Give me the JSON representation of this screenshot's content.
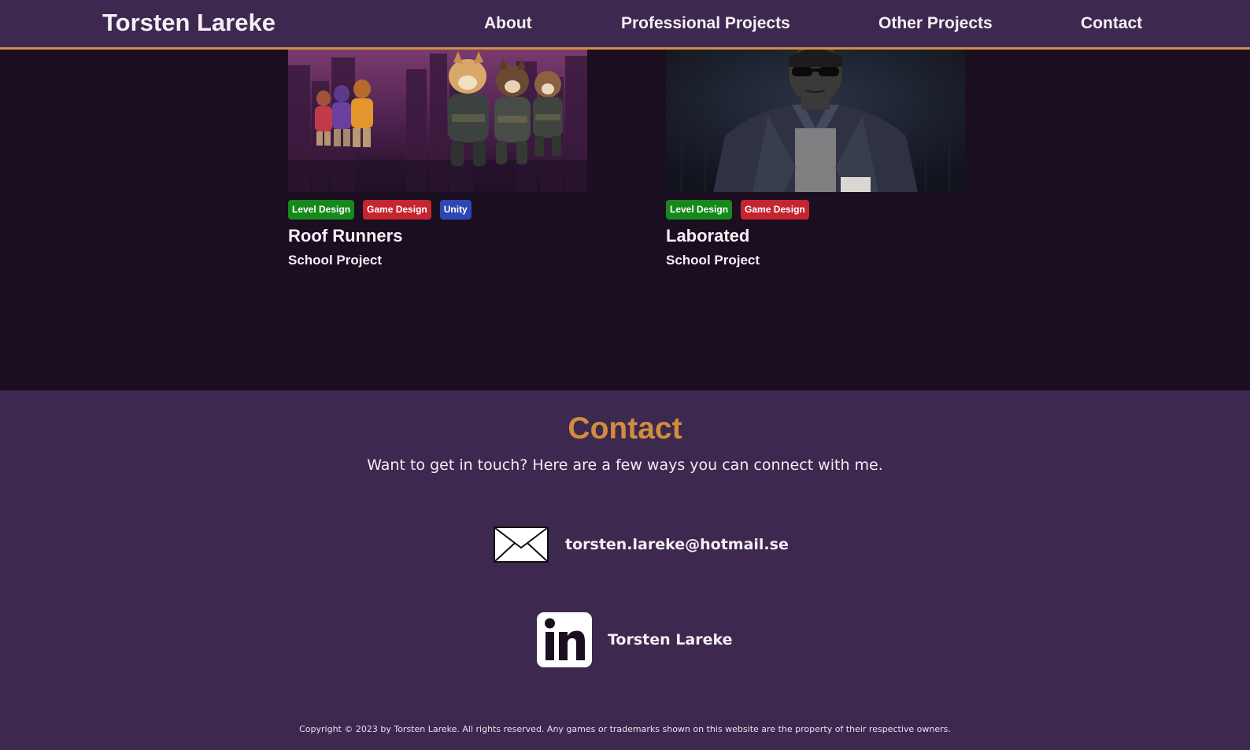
{
  "header": {
    "brand": "Torsten Lareke",
    "nav": [
      "About",
      "Professional Projects",
      "Other Projects",
      "Contact"
    ]
  },
  "projects": [
    {
      "title": "Roof Runners",
      "subtitle": "School Project",
      "tags": [
        {
          "label": "Level Design",
          "color": "#17881c"
        },
        {
          "label": "Game Design",
          "color": "#c42530"
        },
        {
          "label": "Unity",
          "color": "#2c47b2"
        }
      ]
    },
    {
      "title": "Laborated",
      "subtitle": "School Project",
      "tags": [
        {
          "label": "Level Design",
          "color": "#17881c"
        },
        {
          "label": "Game Design",
          "color": "#c42530"
        }
      ]
    }
  ],
  "contact": {
    "heading": "Contact",
    "intro": "Want to get in touch? Here are a few ways you can connect with me.",
    "email": "torsten.lareke@hotmail.se",
    "linkedin": "Torsten Lareke",
    "linkedin_logo_text": "in"
  },
  "footer": {
    "copyright": "Copyright © 2023 by Torsten Lareke. All rights reserved. Any games or trademarks shown on this website are the property of their respective owners."
  },
  "colors": {
    "header_bg": "#3d2850",
    "accent": "#d08d3c",
    "page_bg": "#1a0e20"
  },
  "icons": {
    "email": "envelope-icon",
    "linkedin": "linkedin-icon"
  }
}
